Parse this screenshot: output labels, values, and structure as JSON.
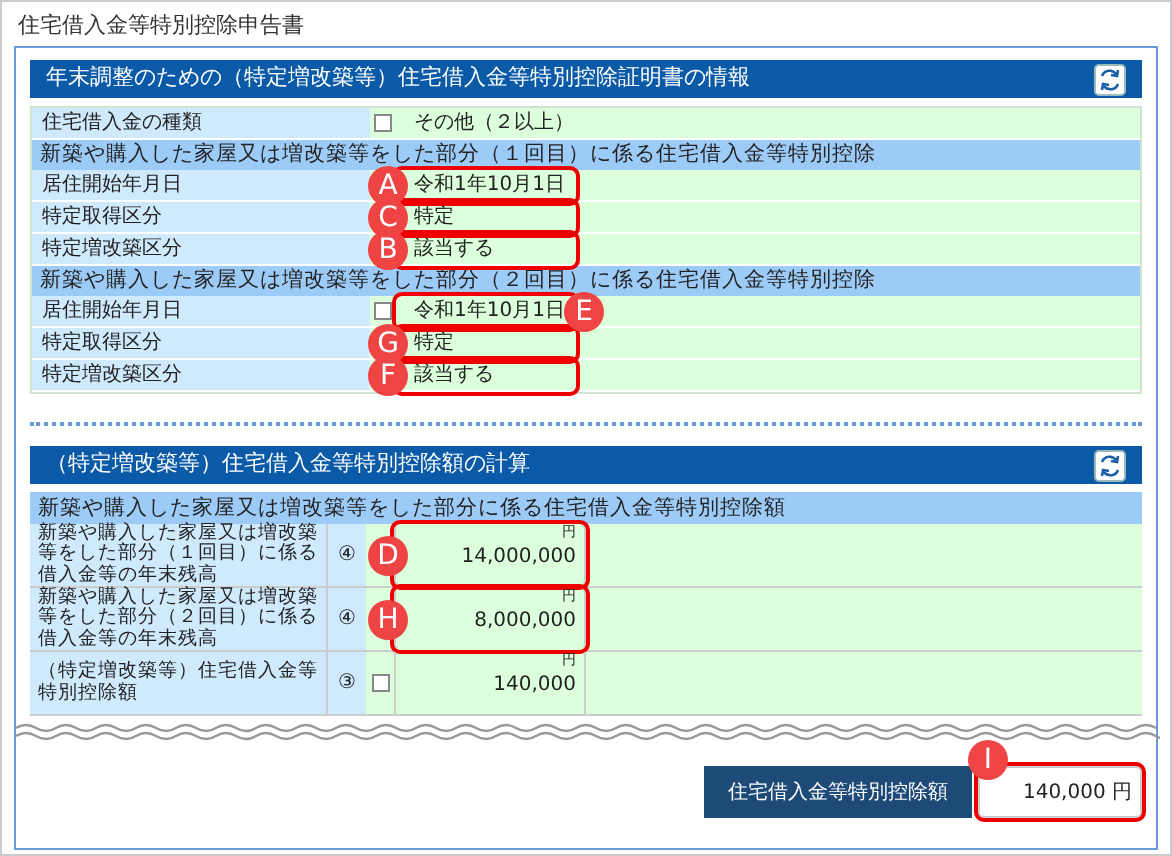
{
  "title": "住宅借入金等特別控除申告書",
  "certificate": {
    "header": "年末調整のための（特定増改築等）住宅借入金等特別控除証明書の情報",
    "items": [
      {
        "kind": "row",
        "label": "住宅借入金の種類",
        "checkbox": {
          "checked": false
        },
        "value": "その他（２以上）"
      },
      {
        "kind": "subheader",
        "label": "新築や購入した家屋又は増改築等をした部分（１回目）に係る住宅借入金等特別控除"
      },
      {
        "kind": "row",
        "label": "居住開始年月日",
        "value": "令和1年10月1日",
        "callout": {
          "letter": "A",
          "kind": "left"
        }
      },
      {
        "kind": "row",
        "label": "特定取得区分",
        "value": "特定",
        "callout": {
          "letter": "C",
          "kind": "left"
        }
      },
      {
        "kind": "row",
        "label": "特定増改築区分",
        "value": "該当する",
        "callout": {
          "letter": "B",
          "kind": "left"
        }
      },
      {
        "kind": "subheader",
        "label": "新築や購入した家屋又は増改築等をした部分（２回目）に係る住宅借入金等特別控除"
      },
      {
        "kind": "row",
        "label": "居住開始年月日",
        "checkbox": {
          "checked": false
        },
        "value": "令和1年10月1日",
        "callout": {
          "letter": "E",
          "kind": "right"
        }
      },
      {
        "kind": "row",
        "label": "特定取得区分",
        "value": "特定",
        "callout": {
          "letter": "G",
          "kind": "left"
        }
      },
      {
        "kind": "row",
        "label": "特定増改築区分",
        "value": "該当する",
        "callout": {
          "letter": "F",
          "kind": "left"
        }
      }
    ]
  },
  "calculation": {
    "header": "（特定増改築等）住宅借入金等特別控除額の計算",
    "subheader": "新築や購入した家屋又は増改築等をした部分に係る住宅借入金等特別控除額",
    "rows": [
      {
        "label": "新築や購入した家屋又は増改築等をした部分（１回目）に係る借入金等の年末残高",
        "number": "④",
        "unit": "円",
        "value": "14,000,000",
        "callout": {
          "letter": "D",
          "kind": "left"
        }
      },
      {
        "label": "新築や購入した家屋又は増改築等をした部分（２回目）に係る借入金等の年末残高",
        "number": "④",
        "unit": "円",
        "value": "8,000,000",
        "callout": {
          "letter": "H",
          "kind": "left"
        }
      },
      {
        "label": "（特定増改築等）住宅借入金等特別控除額",
        "number": "③",
        "checkbox": {
          "checked": false
        },
        "unit": "円",
        "value": "140,000"
      }
    ]
  },
  "total": {
    "label": "住宅借入金等特別控除額",
    "value": "140,000 円",
    "callout": {
      "letter": "I",
      "kind": "top"
    }
  }
}
